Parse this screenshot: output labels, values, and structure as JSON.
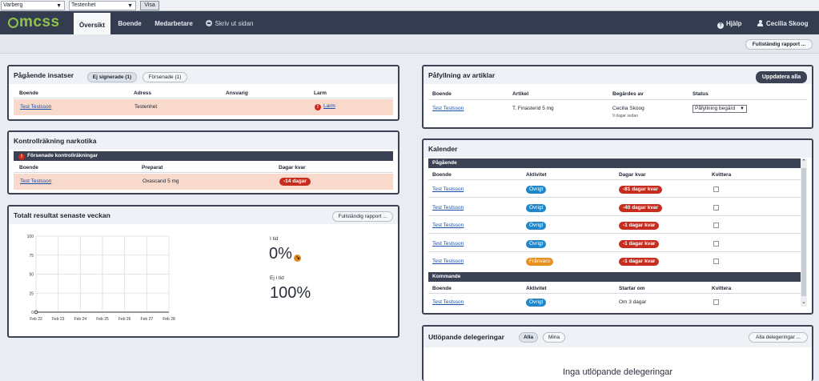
{
  "selectors": {
    "unit": "Varberg",
    "subunit": "Testenhet",
    "show_label": "Visa"
  },
  "nav": {
    "logo": "mcss",
    "items": [
      "Översikt",
      "Boende",
      "Medarbetare"
    ],
    "print_label": "Skriv ut sidan",
    "help_label": "Hjälp",
    "user_name": "Cecilia Skoog"
  },
  "subbar": {
    "full_report_label": "Fullständig rapport ..."
  },
  "ongoing": {
    "title": "Pågående insatser",
    "tabs": [
      "Ej signerade (1)",
      "Försenade (1)"
    ],
    "columns": [
      "Boende",
      "Adress",
      "Ansvarig",
      "Larm"
    ],
    "rows": [
      {
        "resident": "Test Testsson",
        "address": "Testenhet",
        "responsible": "",
        "alarm": "Larm"
      }
    ]
  },
  "narcotics": {
    "title": "Kontrollräkning narkotika",
    "banner": "Försenade kontrollräkningar",
    "columns": [
      "Boende",
      "Preparat",
      "Dagar kvar"
    ],
    "rows": [
      {
        "resident": "Test Testsson",
        "drug": "Oxascand 5 mg",
        "days_left": "-14 dagar"
      }
    ]
  },
  "weekly": {
    "title": "Totalt resultat senaste veckan",
    "report_label": "Fullständig rapport ...",
    "on_time_label": "I tid",
    "on_time_value": "0%",
    "late_label": "Ej i tid",
    "late_value": "100%"
  },
  "chart_data": {
    "type": "line",
    "title": "",
    "xlabel": "",
    "ylabel": "",
    "categories": [
      "Feb 22",
      "Feb 23",
      "Feb 24",
      "Feb 25",
      "Feb 26",
      "Feb 27",
      "Feb 28"
    ],
    "y_ticks": [
      0,
      25,
      50,
      75,
      100
    ],
    "ylim": [
      0,
      100
    ],
    "grid": true,
    "series": [
      {
        "values": [
          0,
          null,
          null,
          null,
          null,
          null,
          null
        ]
      }
    ]
  },
  "refill": {
    "title": "Påfyllning av artiklar",
    "update_all_label": "Uppdatera alla",
    "columns": [
      "Boende",
      "Artikel",
      "Begärdes av",
      "Status"
    ],
    "rows": [
      {
        "resident": "Test Testsson",
        "article": "T. Finasterid 5 mg",
        "requested_by": "Cecilia Skoog",
        "requested_when": "9 dagar sedan",
        "status": "Påfyllning begärd"
      }
    ]
  },
  "calendar": {
    "title": "Kalender",
    "ongoing_label": "Pågående",
    "ongoing_columns": [
      "Boende",
      "Aktivitet",
      "Dagar kvar",
      "Kvittera"
    ],
    "ongoing_rows": [
      {
        "resident": "Test Testsson",
        "activity": "Övrigt",
        "days": "-81 dagar kvar",
        "color": "#1f87c9"
      },
      {
        "resident": "Test Testsson",
        "activity": "Övrigt",
        "days": "-40 dagar kvar",
        "color": "#1f87c9"
      },
      {
        "resident": "Test Testsson",
        "activity": "Övrigt",
        "days": "-1 dagar kvar",
        "color": "#1f87c9"
      },
      {
        "resident": "Test Testsson",
        "activity": "Övrigt",
        "days": "-1 dagar kvar",
        "color": "#1f87c9"
      },
      {
        "resident": "Test Testsson",
        "activity": "Frånvaro",
        "days": "-1 dagar kvar",
        "color": "#e8901f"
      }
    ],
    "upcoming_label": "Kommande",
    "upcoming_columns": [
      "Boende",
      "Aktivitet",
      "Startar om",
      "Kvittera"
    ],
    "upcoming_rows": [
      {
        "resident": "Test Testsson",
        "activity": "Övrigt",
        "starts": "Om 3 dagar"
      }
    ]
  },
  "delegations": {
    "title": "Utlöpande delegeringar",
    "tabs": [
      "Alla",
      "Mina"
    ],
    "all_label": "Alla delegeringar ...",
    "empty_text": "Inga utlöpande delegeringar"
  }
}
